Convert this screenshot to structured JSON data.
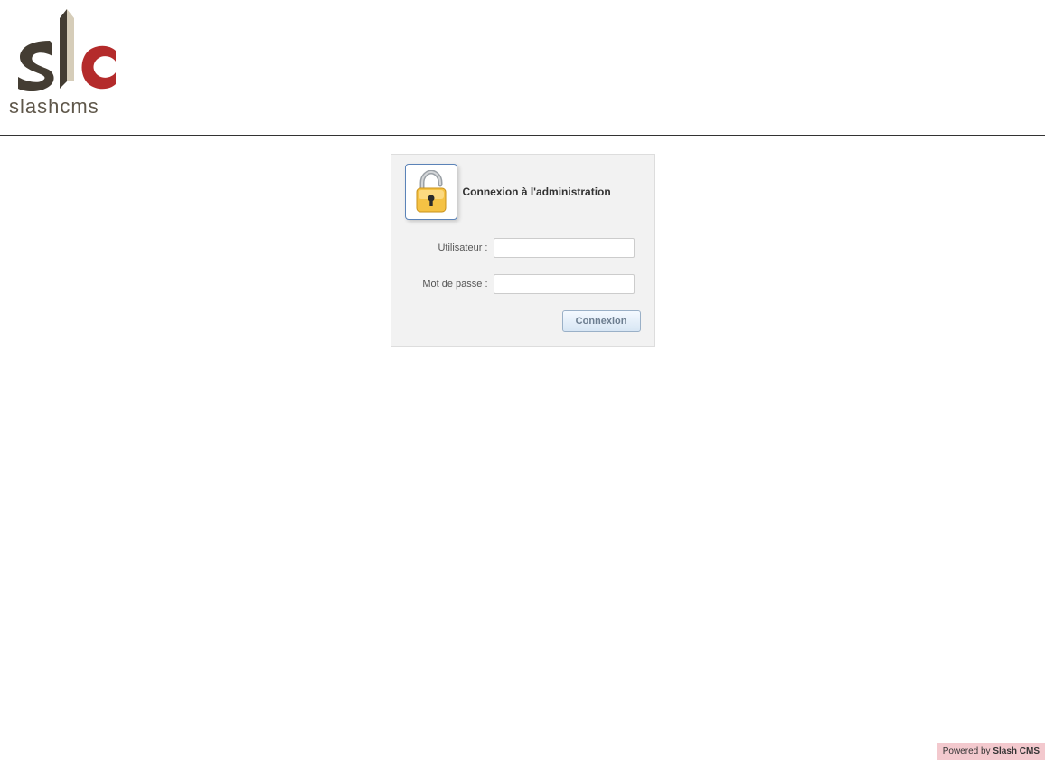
{
  "brand": {
    "name": "slashcms"
  },
  "login": {
    "title": "Connexion à l'administration",
    "user_label": "Utilisateur :",
    "password_label": "Mot de passe :",
    "submit_label": "Connexion",
    "user_value": "",
    "password_value": ""
  },
  "footer": {
    "prefix": "Powered by ",
    "brand": "Slash CMS"
  }
}
